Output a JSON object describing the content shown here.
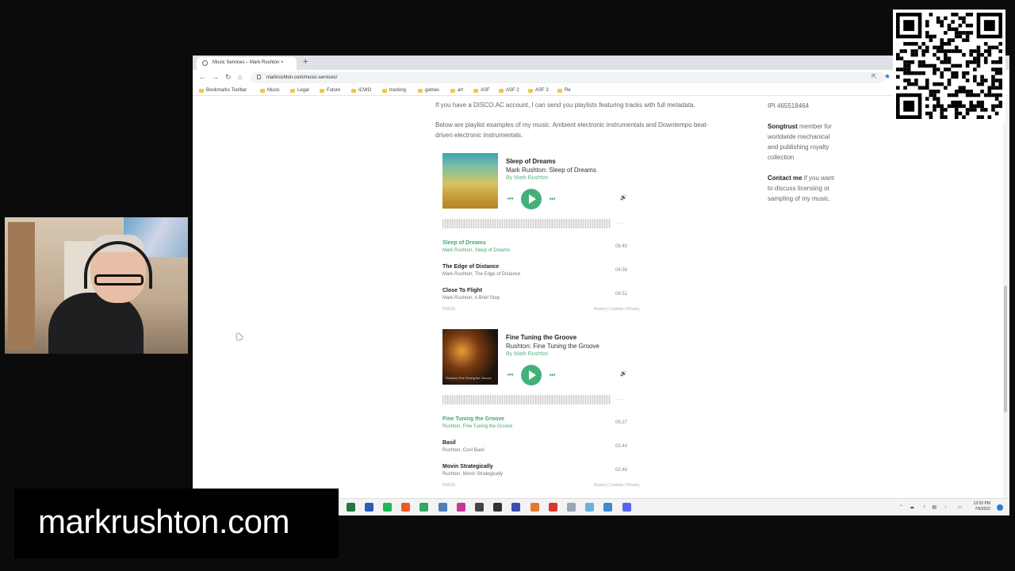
{
  "browser": {
    "tab_title": "Music Services – Mark Rushton ×",
    "new_tab_label": "+",
    "url": "markrushton.com/music-services/",
    "bookmarks": [
      "Bookmarks Toolbar",
      "Music",
      "Legal",
      "Future",
      "ICWO",
      "tracking",
      "games",
      "art",
      "ASF",
      "ASF 2",
      "ASF 3",
      "Re"
    ]
  },
  "page": {
    "intro_line1": "If you have a DISCO.AC account, I can send you playlists featuring tracks with full metadata.",
    "intro_line2a": "Below are playlist examples of my music. Ambient electronic instrumentals and Downtempo beat-",
    "intro_line2b": "driven electronic instrumentals.",
    "sidebar": {
      "ipi": "IPI 465518464",
      "songtrust_bold": "Songtrust",
      "songtrust_l1": " member for",
      "songtrust_l2": "worldwide mechanical",
      "songtrust_l3": "and publishing royalty",
      "songtrust_l4": "collection",
      "contact_bold": "Contact me",
      "contact_l1": " if you want",
      "contact_l2": "to discuss licensing or",
      "contact_l3": "sampling of my music."
    }
  },
  "embeds": [
    {
      "title": "Sleep of Dreams",
      "subtitle": "Mark Rushton: Sleep of Dreams",
      "by": "By Mark Rushton",
      "wave_time": "--:--",
      "tracks": [
        {
          "title": "Sleep of Dreams",
          "artist": "Mark Rushton, Sleep of Dreams",
          "duration": "06:40",
          "active": true
        },
        {
          "title": "The Edge of Distance",
          "artist": "Mark Rushton, The Edge of Distance",
          "duration": "04:56",
          "active": false
        },
        {
          "title": "Close To Flight",
          "artist": "Mark Rushton, A Brief Stop",
          "duration": "04:51",
          "active": false
        }
      ],
      "footer_left": "DISCO",
      "footer_right": "Report | Cookies | Privacy"
    },
    {
      "title": "Fine Tuning the Groove",
      "subtitle": "Rushton: Fine Tuning the Groove",
      "by": "By Mark Rushton",
      "art_label": "Rushton\nFine Tuning the Groove",
      "wave_time": "--:--",
      "tracks": [
        {
          "title": "Fine Tuning the Groove",
          "artist": "Rushton, Fine Tuning the Groove",
          "duration": "06:27",
          "active": true
        },
        {
          "title": "Basil",
          "artist": "Rushton, Cool Basil",
          "duration": "02:44",
          "active": false
        },
        {
          "title": "Movin Strategically",
          "artist": "Rushton, Movin Strategically",
          "duration": "02:46",
          "active": false
        }
      ],
      "footer_left": "DISCO",
      "footer_right": "Report | Cookies | Privacy"
    }
  ],
  "taskbar": {
    "time": "12:52 PM",
    "date": "7/6/2022",
    "icon_colors": [
      "#6b6b6b",
      "#d84c2c",
      "#e04a1e",
      "#e8a33a",
      "#5fa2d9",
      "#5b5bb0",
      "#c74fb3",
      "#7a3db8",
      "#1f7a3f",
      "#2b5db5",
      "#1db954",
      "#f05a22",
      "#2fa862",
      "#4b7fb8",
      "#c7379a",
      "#444444",
      "#333333",
      "#3b4db0",
      "#e07a2a",
      "#d93a2b",
      "#9aa5b1",
      "#6db0e0",
      "#3f8ad6",
      "#5865f2"
    ]
  },
  "overlay": {
    "caption": "markrushton.com"
  }
}
